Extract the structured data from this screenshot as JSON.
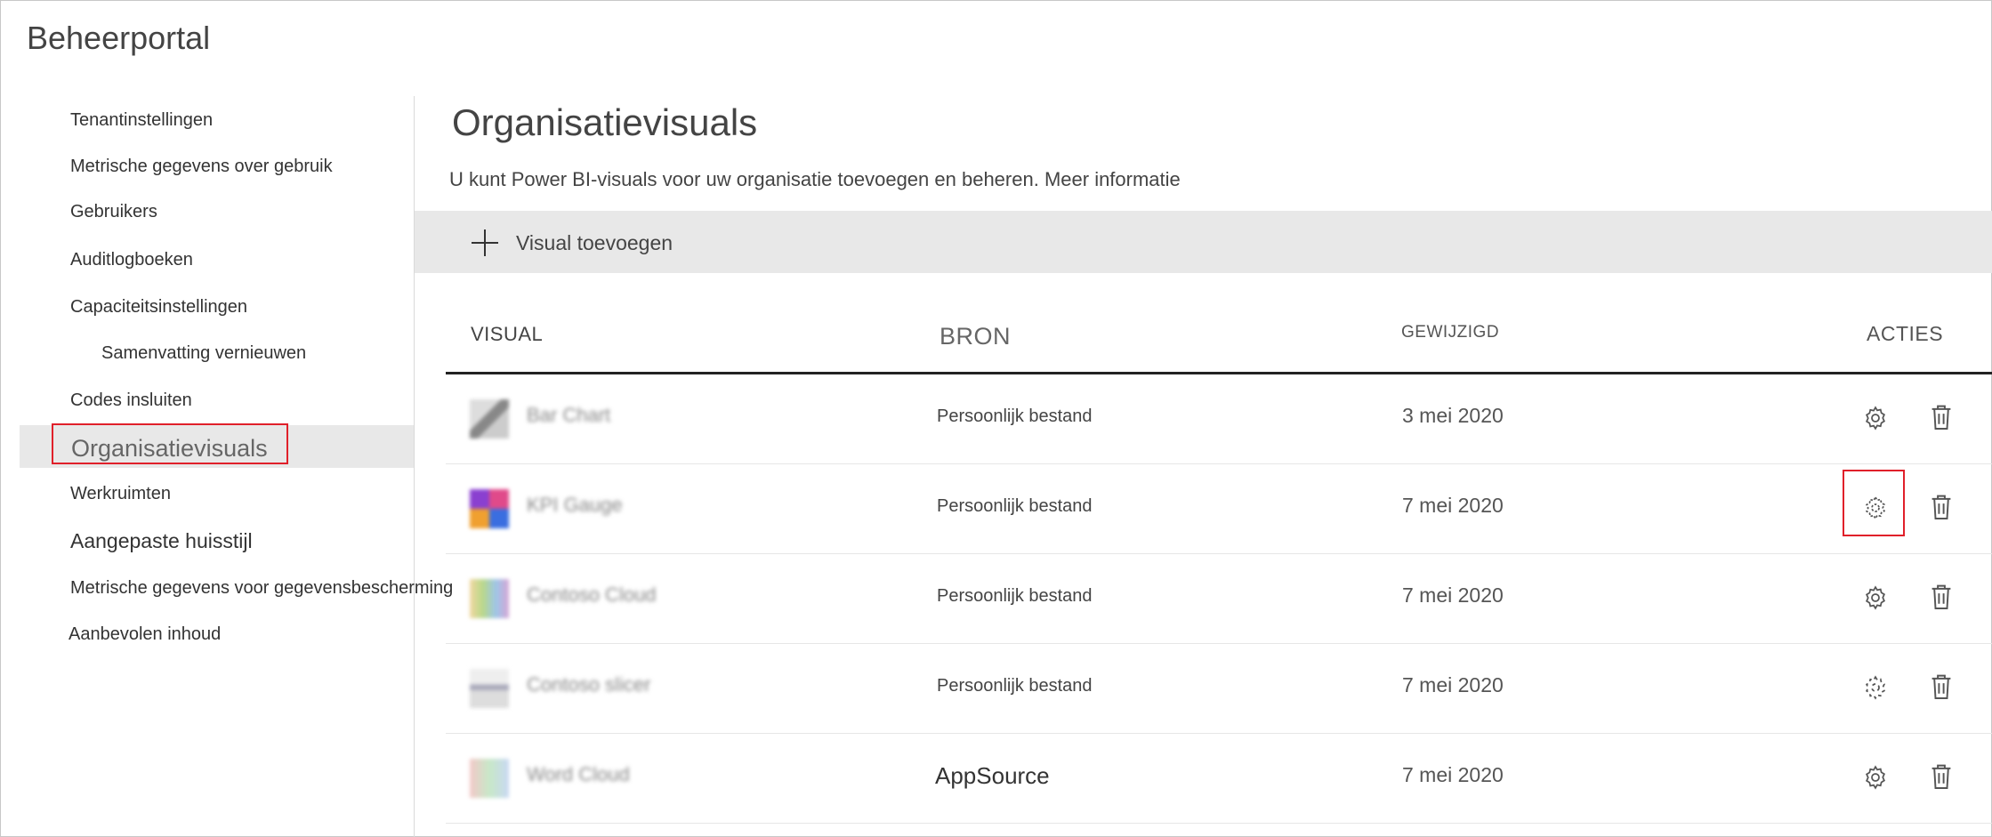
{
  "portal": {
    "title": "Beheerportal"
  },
  "sidebar": {
    "items": [
      {
        "label": "Tenantinstellingen"
      },
      {
        "label": "Metrische gegevens over gebruik"
      },
      {
        "label": "Gebruikers"
      },
      {
        "label": "Auditlogboeken"
      },
      {
        "label": "Capaciteitsinstellingen"
      },
      {
        "label": "Samenvatting vernieuwen"
      },
      {
        "label": "Codes insluiten"
      },
      {
        "label": "Organisatievisuals"
      },
      {
        "label": "Werkruimten"
      },
      {
        "label": "Aangepaste huisstijl"
      },
      {
        "label": "Metrische gegevens voor gegevensbescherming"
      },
      {
        "label": "Aanbevolen inhoud"
      }
    ]
  },
  "main": {
    "title": "Organisatievisuals",
    "description": "U kunt Power BI-visuals voor uw organisatie toevoegen en beheren.",
    "more_info": "Meer informatie",
    "add_label": "Visual toevoegen"
  },
  "table": {
    "headers": {
      "visual": "VISUAL",
      "bron": "BRON",
      "gewijzigd": "GEWIJZIGD",
      "acties": "ACTIES"
    },
    "rows": [
      {
        "name": "Bar Chart",
        "source": "Persoonlijk bestand",
        "modified": "3 mei 2020"
      },
      {
        "name": "KPI Gauge",
        "source": "Persoonlijk bestand",
        "modified": "7 mei 2020"
      },
      {
        "name": "Contoso Cloud",
        "source": "Persoonlijk bestand",
        "modified": "7 mei 2020"
      },
      {
        "name": "Contoso slicer",
        "source": "Persoonlijk bestand",
        "modified": "7 mei 2020"
      },
      {
        "name": "Word Cloud",
        "source": "AppSource",
        "modified": "7 mei 2020"
      }
    ]
  },
  "colors": {
    "highlight": "#e0202a",
    "toolbar_bg": "#e8e8e8",
    "active_nav_bg": "#e8e8e8"
  },
  "icons": [
    "plus-icon",
    "gear-icon",
    "trash-icon"
  ]
}
